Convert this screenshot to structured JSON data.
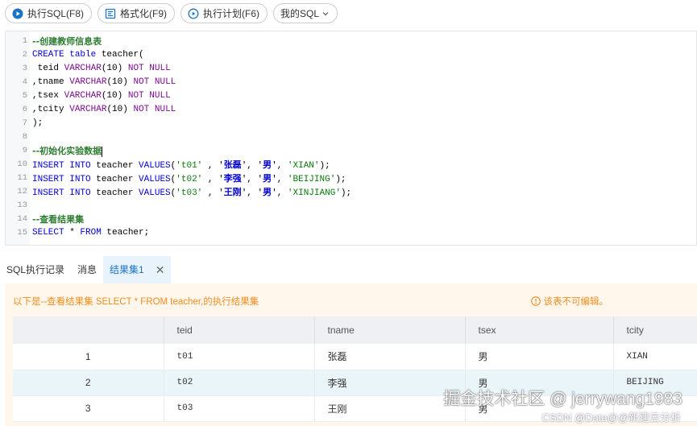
{
  "toolbar": {
    "run_label": "执行SQL(F8)",
    "format_label": "格式化(F9)",
    "plan_label": "执行计划(F6)",
    "mysql_label": "我的SQL"
  },
  "editor": {
    "lines": [
      {
        "n": "1",
        "text": "--创建教师信息表"
      },
      {
        "n": "2",
        "text": "CREATE table teacher("
      },
      {
        "n": "3",
        "text": " teid VARCHAR(10) NOT NULL"
      },
      {
        "n": "4",
        "text": ",tname VARCHAR(10) NOT NULL"
      },
      {
        "n": "5",
        "text": ",tsex VARCHAR(10) NOT NULL"
      },
      {
        "n": "6",
        "text": ",tcity VARCHAR(10) NOT NULL"
      },
      {
        "n": "7",
        "text": ");"
      },
      {
        "n": "8",
        "text": ""
      },
      {
        "n": "9",
        "text": "--初始化实验数据"
      },
      {
        "n": "10",
        "text": "INSERT INTO teacher VALUES('t01' , '张磊', '男', 'XIAN');"
      },
      {
        "n": "11",
        "text": "INSERT INTO teacher VALUES('t02' , '李强', '男', 'BEIJING');"
      },
      {
        "n": "12",
        "text": "INSERT INTO teacher VALUES('t03' , '王刚', '男', 'XINJIANG');"
      },
      {
        "n": "13",
        "text": ""
      },
      {
        "n": "14",
        "text": "--查看结果集"
      },
      {
        "n": "15",
        "text": "SELECT * FROM teacher;"
      }
    ]
  },
  "tabs": {
    "history": "SQL执行记录",
    "messages": "消息",
    "result1": "结果集1"
  },
  "result": {
    "notice": "以下是--查看结果集 SELECT * FROM teacher,的执行结果集",
    "readonly": "该表不可编辑。",
    "columns": [
      "",
      "teid",
      "tname",
      "tsex",
      "tcity"
    ],
    "rows": [
      {
        "idx": "1",
        "teid": "t01",
        "tname": "张磊",
        "tsex": "男",
        "tcity": "XIAN"
      },
      {
        "idx": "2",
        "teid": "t02",
        "tname": "李强",
        "tsex": "男",
        "tcity": "BEIJING"
      },
      {
        "idx": "3",
        "teid": "t03",
        "tname": "王刚",
        "tsex": "男",
        "tcity": ""
      }
    ]
  },
  "watermark": {
    "main": "掘金技术社区 @ jerrywang1983",
    "sub": "CSDN @Data@@新建云分析"
  },
  "colors": {
    "accent": "#1a73c7",
    "warning": "#f08c1e",
    "keyword": "#0000d4",
    "comment": "#2e7d32"
  }
}
